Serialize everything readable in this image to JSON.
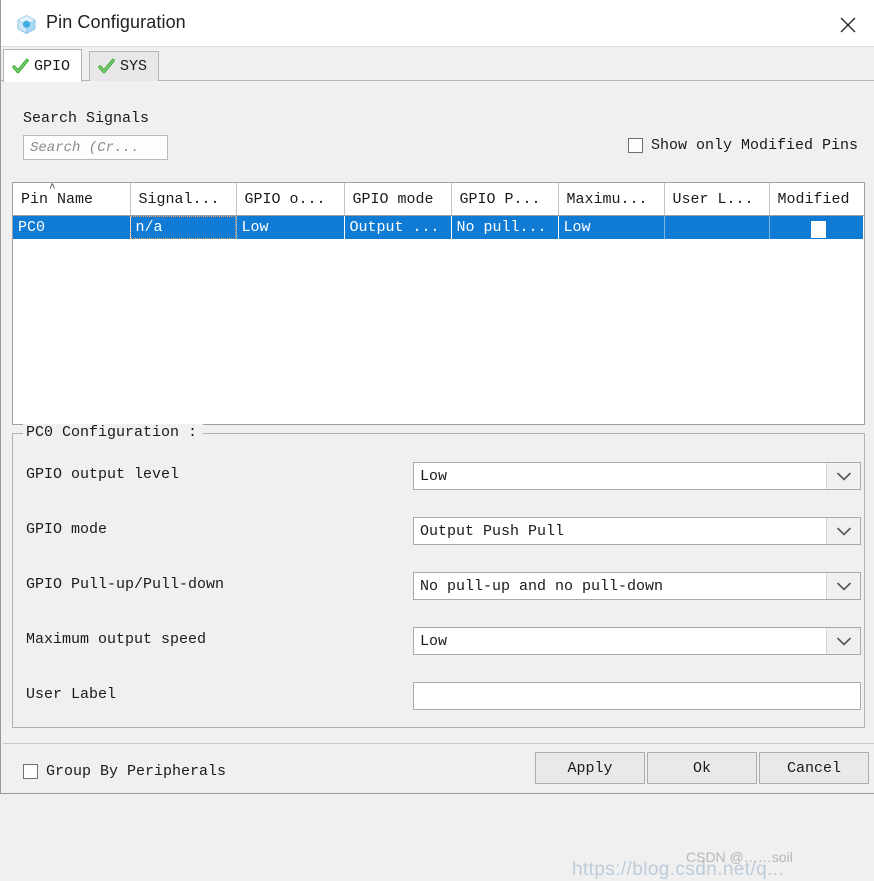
{
  "window": {
    "title": "Pin Configuration",
    "icon": "cube-icon",
    "close_label": "close-icon",
    "accent_selection": "#0f7bd4",
    "background": "#f0f0f0"
  },
  "tabs": [
    {
      "label": "GPIO",
      "active": true,
      "status_icon": "green-check-icon"
    },
    {
      "label": "SYS",
      "active": false,
      "status_icon": "green-check-icon"
    }
  ],
  "search": {
    "label": "Search Signals",
    "placeholder": "Search (Cr...",
    "value": ""
  },
  "filter": {
    "show_only_modified_label": "Show only Modified Pins",
    "checked": false
  },
  "table": {
    "columns": [
      "Pin Name",
      "Signal...",
      "GPIO o...",
      "GPIO mode",
      "GPIO P...",
      "Maximu...",
      "User L...",
      "Modified"
    ],
    "sorted_column": "Pin Name",
    "sort_direction": "ascending",
    "rows": [
      {
        "selected": true,
        "pin_name": "PC0",
        "signal": "n/a",
        "gpio_output_level": "Low",
        "gpio_mode": "Output ...",
        "gpio_pull": "No pull...",
        "maximum_output_speed": "Low",
        "user_label": "",
        "modified": true
      }
    ]
  },
  "config": {
    "title": "PC0 Configuration :",
    "fields": [
      {
        "label": "GPIO output level",
        "value": "Low",
        "type": "combo"
      },
      {
        "label": "GPIO mode",
        "value": "Output Push Pull",
        "type": "combo"
      },
      {
        "label": "GPIO Pull-up/Pull-down",
        "value": "No pull-up and no pull-down",
        "type": "combo"
      },
      {
        "label": "Maximum output speed",
        "value": "Low",
        "type": "combo"
      },
      {
        "label": "User Label",
        "value": "",
        "type": "text"
      }
    ]
  },
  "footer": {
    "group_by_peripherals_label": "Group By Peripherals",
    "group_by_peripherals_checked": false,
    "apply_label": "Apply",
    "ok_label": "Ok",
    "cancel_label": "Cancel"
  },
  "watermark": {
    "url": "https://blog.csdn.net/q...",
    "user": "CSDN @……soil"
  }
}
